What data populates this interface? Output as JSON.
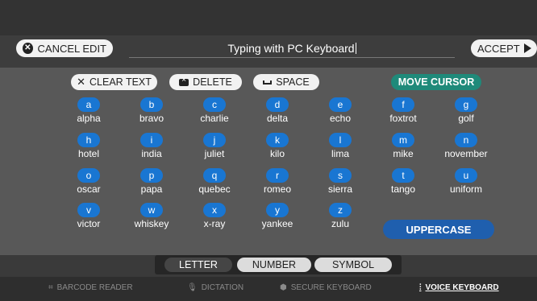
{
  "header": {
    "cancel_label": "CANCEL EDIT",
    "title": "Typing with PC Keyboard",
    "accept_label": "ACCEPT"
  },
  "toolbar": {
    "clear_label": "CLEAR TEXT",
    "delete_label": "DELETE",
    "space_label": "SPACE",
    "move_label": "MOVE CURSOR"
  },
  "keys": [
    {
      "letter": "a",
      "word": "alpha"
    },
    {
      "letter": "b",
      "word": "bravo"
    },
    {
      "letter": "c",
      "word": "charlie"
    },
    {
      "letter": "d",
      "word": "delta"
    },
    {
      "letter": "e",
      "word": "echo"
    },
    {
      "letter": "f",
      "word": "foxtrot"
    },
    {
      "letter": "g",
      "word": "golf"
    },
    {
      "letter": "h",
      "word": "hotel"
    },
    {
      "letter": "i",
      "word": "india"
    },
    {
      "letter": "j",
      "word": "juliet"
    },
    {
      "letter": "k",
      "word": "kilo"
    },
    {
      "letter": "l",
      "word": "lima"
    },
    {
      "letter": "m",
      "word": "mike"
    },
    {
      "letter": "n",
      "word": "november"
    },
    {
      "letter": "o",
      "word": "oscar"
    },
    {
      "letter": "p",
      "word": "papa"
    },
    {
      "letter": "q",
      "word": "quebec"
    },
    {
      "letter": "r",
      "word": "romeo"
    },
    {
      "letter": "s",
      "word": "sierra"
    },
    {
      "letter": "t",
      "word": "tango"
    },
    {
      "letter": "u",
      "word": "uniform"
    },
    {
      "letter": "v",
      "word": "victor"
    },
    {
      "letter": "w",
      "word": "whiskey"
    },
    {
      "letter": "x",
      "word": "x-ray"
    },
    {
      "letter": "y",
      "word": "yankee"
    },
    {
      "letter": "z",
      "word": "zulu"
    }
  ],
  "uppercase_label": "UPPERCASE",
  "tabs": [
    {
      "label": "LETTER",
      "active": true
    },
    {
      "label": "NUMBER",
      "active": false
    },
    {
      "label": "SYMBOL",
      "active": false
    }
  ],
  "modes": [
    {
      "label": "BARCODE READER",
      "icon": "barcode-icon",
      "active": false
    },
    {
      "label": "DICTATION",
      "icon": "microphone-icon",
      "active": false
    },
    {
      "label": "SECURE KEYBOARD",
      "icon": "shield-icon",
      "active": false
    },
    {
      "label": "VOICE KEYBOARD",
      "icon": "voice-icon",
      "active": true
    }
  ],
  "colors": {
    "key_blue": "#1976d2",
    "move_teal": "#1f8a7a",
    "uppercase_blue": "#1f5fae"
  }
}
